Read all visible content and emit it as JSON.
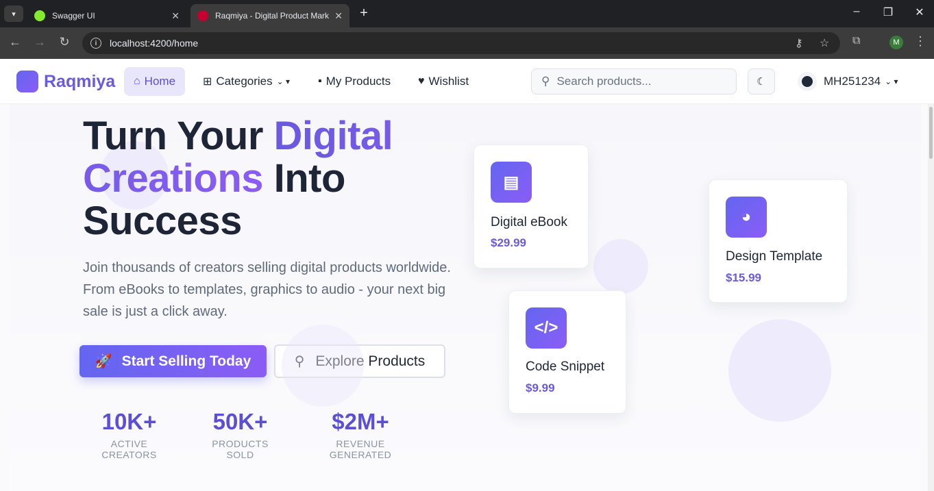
{
  "browser": {
    "tabs": [
      {
        "title": "Swagger UI",
        "favicon_color": "#85ea2d"
      },
      {
        "title": "Raqmiya - Digital Product Mark",
        "favicon_color": "#c3002f"
      }
    ],
    "url": "localhost:4200/home",
    "profile_initial": "M",
    "new_tab_symbol": "+"
  },
  "navbar": {
    "brand": "Raqmiya",
    "items": [
      {
        "label": "Home",
        "icon": "house-icon",
        "active": true
      },
      {
        "label": "Categories",
        "icon": "grid-icon",
        "dropdown": true
      },
      {
        "label": "My Products",
        "icon": "box-icon"
      },
      {
        "label": "Wishlist",
        "icon": "heart-icon"
      }
    ],
    "search_placeholder": "Search products...",
    "username": "MH251234"
  },
  "hero": {
    "headline_part1": "Turn Your ",
    "headline_accent": "Digital Creations",
    "headline_part2": " Into Success",
    "subtext": "Join thousands of creators selling digital products worldwide. From eBooks to templates, graphics to audio - your next big sale is just a click away.",
    "primary_button": "Start Selling Today",
    "secondary_button": "Explore Products",
    "stats": [
      {
        "value": "10K+",
        "label": "ACTIVE CREATORS"
      },
      {
        "value": "50K+",
        "label": "PRODUCTS SOLD"
      },
      {
        "value": "$2M+",
        "label": "REVENUE GENERATED"
      }
    ]
  },
  "cards": [
    {
      "name": "Digital eBook",
      "price": "$29.99",
      "icon": "book-icon"
    },
    {
      "name": "Design Template",
      "price": "$15.99",
      "icon": "palette-icon"
    },
    {
      "name": "Code Snippet",
      "price": "$9.99",
      "icon": "code-icon"
    }
  ],
  "colors": {
    "accent": "#6a5ae0",
    "accent_light": "#8b5cf6",
    "text_dark": "#1e2536",
    "text_muted": "#5f6b7c"
  }
}
